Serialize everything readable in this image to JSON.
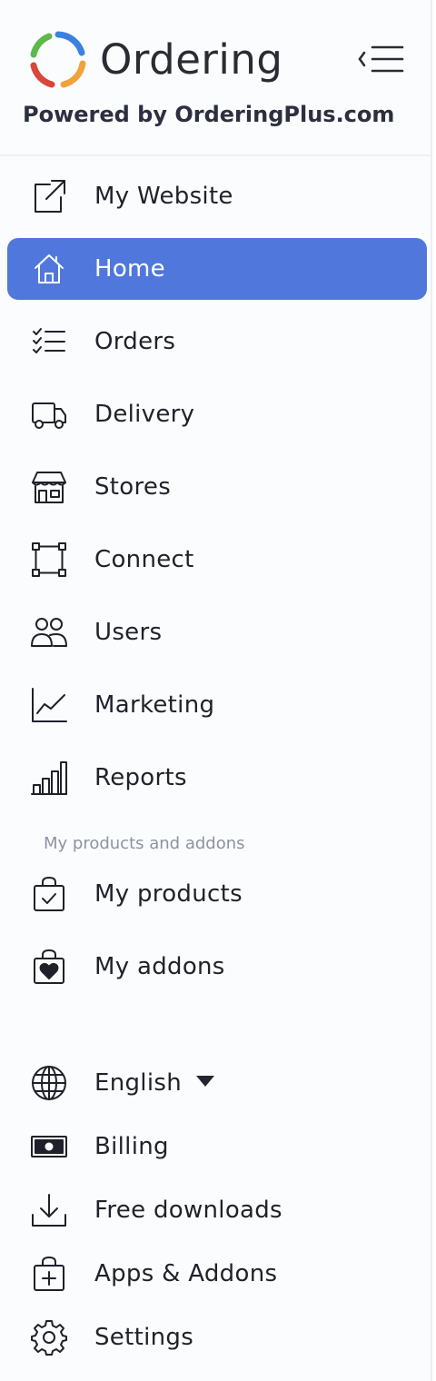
{
  "header": {
    "app_name": "Ordering",
    "tagline": "Powered by OrderingPlus.com"
  },
  "nav": {
    "items": [
      {
        "label": "My Website",
        "icon": "external-link-icon"
      },
      {
        "label": "Home",
        "icon": "home-icon",
        "active": true
      },
      {
        "label": "Orders",
        "icon": "list-check-icon"
      },
      {
        "label": "Delivery",
        "icon": "truck-icon"
      },
      {
        "label": "Stores",
        "icon": "shop-icon"
      },
      {
        "label": "Connect",
        "icon": "bounding-box-icon"
      },
      {
        "label": "Users",
        "icon": "people-icon"
      },
      {
        "label": "Marketing",
        "icon": "graph-up-icon"
      },
      {
        "label": "Reports",
        "icon": "bar-chart-icon"
      }
    ]
  },
  "products_section": {
    "label": "My products and addons",
    "items": [
      {
        "label": "My products",
        "icon": "bag-check-icon"
      },
      {
        "label": "My addons",
        "icon": "bag-heart-icon"
      }
    ]
  },
  "footer_nav": {
    "language": {
      "label": "English",
      "icon": "globe-icon"
    },
    "items": [
      {
        "label": "Billing",
        "icon": "cash-icon"
      },
      {
        "label": "Free downloads",
        "icon": "download-icon"
      },
      {
        "label": "Apps & Addons",
        "icon": "bag-plus-icon"
      },
      {
        "label": "Settings",
        "icon": "gear-icon"
      }
    ]
  },
  "colors": {
    "active_bg": "#5078dc",
    "logo_blue": "#3b82e0",
    "logo_green": "#5fb84a",
    "logo_orange": "#f2a23a",
    "logo_red": "#d9463a"
  }
}
